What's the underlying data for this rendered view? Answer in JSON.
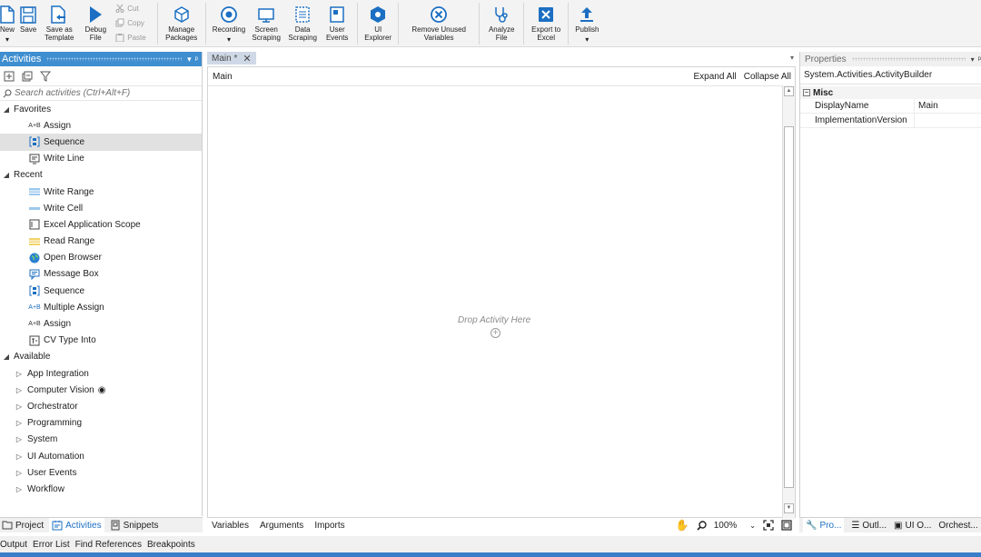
{
  "ribbon": {
    "new": "New",
    "save": "Save",
    "save_as_template": "Save as Template",
    "debug_file": "Debug File",
    "cut": "Cut",
    "copy": "Copy",
    "paste": "Paste",
    "manage_packages": "Manage Packages",
    "recording": "Recording",
    "screen_scraping": "Screen Scraping",
    "data_scraping": "Data Scraping",
    "user_events": "User Events",
    "ui_explorer": "UI Explorer",
    "remove_unused_variables": "Remove Unused Variables",
    "analyze_file": "Analyze File",
    "export_to_excel": "Export to Excel",
    "publish": "Publish"
  },
  "activities": {
    "title": "Activities",
    "search_placeholder": "Search activities (Ctrl+Alt+F)",
    "favorites_label": "Favorites",
    "favorites": [
      "Assign",
      "Sequence",
      "Write Line"
    ],
    "recent_label": "Recent",
    "recent": [
      "Write Range",
      "Write Cell",
      "Excel Application Scope",
      "Read Range",
      "Open Browser",
      "Message Box",
      "Sequence",
      "Multiple Assign",
      "Assign",
      "CV Type Into"
    ],
    "available_label": "Available",
    "available": [
      "App Integration",
      "Computer Vision",
      "Orchestrator",
      "Programming",
      "System",
      "UI Automation",
      "User Events",
      "Workflow"
    ]
  },
  "left_tabs": {
    "project": "Project",
    "activities": "Activities",
    "snippets": "Snippets"
  },
  "designer": {
    "tab_label": "Main *",
    "breadcrumb": "Main",
    "expand_all": "Expand All",
    "collapse_all": "Collapse All",
    "drop_hint": "Drop Activity Here",
    "footer_variables": "Variables",
    "footer_arguments": "Arguments",
    "footer_imports": "Imports",
    "zoom": "100%"
  },
  "properties": {
    "title": "Properties",
    "type": "System.Activities.ActivityBuilder",
    "category": "Misc",
    "rows": [
      {
        "key": "DisplayName",
        "value": "Main"
      },
      {
        "key": "ImplementationVersion",
        "value": ""
      }
    ]
  },
  "right_tabs": {
    "properties": "Pro...",
    "outline": "Outl...",
    "ui_objects": "UI O...",
    "orchestrator": "Orchest..."
  },
  "bottom_tabs": [
    "Output",
    "Error List",
    "Find References",
    "Breakpoints"
  ],
  "colors": {
    "accent": "#3e8ed0",
    "status_bar": "#3a7dc9",
    "icon_blue": "#1c6fc2"
  }
}
